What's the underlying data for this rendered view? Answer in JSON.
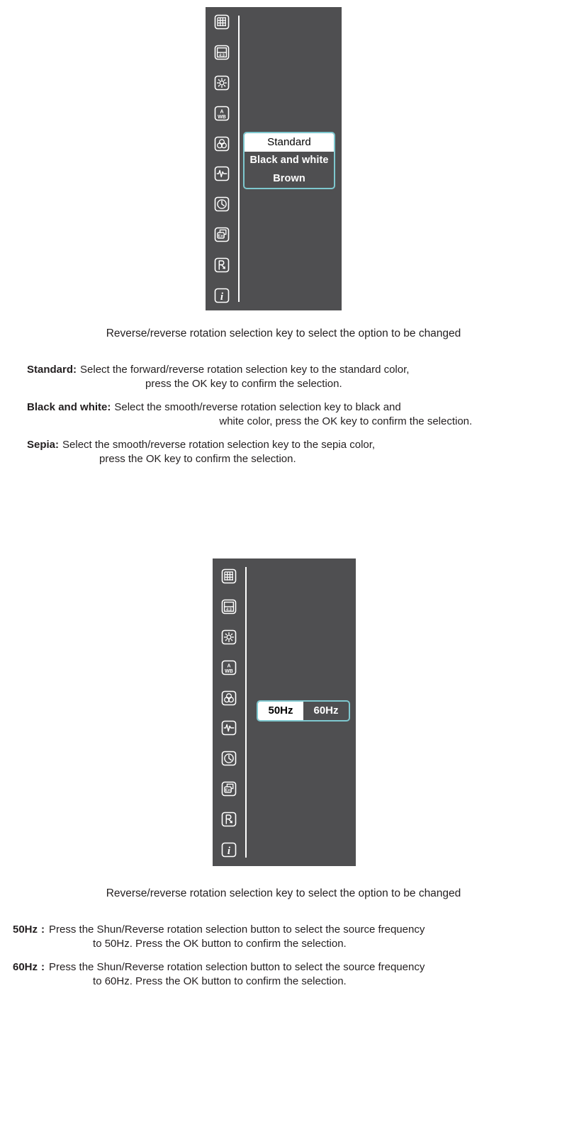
{
  "panels": [
    {
      "id": "color-mode-panel",
      "icons": [
        {
          "name": "grid-icon",
          "label": "Grid"
        },
        {
          "name": "aspect-ratio-4-3-icon",
          "label": "4:3"
        },
        {
          "name": "brightness-icon",
          "label": "Brightness"
        },
        {
          "name": "auto-white-balance-icon",
          "label": "A WB"
        },
        {
          "name": "color-mode-icon",
          "label": "Color mode"
        },
        {
          "name": "sharpness-icon",
          "label": "Sharpness"
        },
        {
          "name": "timer-icon",
          "label": "Timer"
        },
        {
          "name": "language-icon",
          "label": "En"
        },
        {
          "name": "reset-icon",
          "label": "Reset"
        },
        {
          "name": "info-icon",
          "label": "i"
        }
      ],
      "menu": {
        "name": "color-mode-menu",
        "options": [
          {
            "label": "Standard",
            "selected": true
          },
          {
            "label": "Black and white",
            "selected": false
          },
          {
            "label": "Brown",
            "selected": false
          }
        ]
      }
    },
    {
      "id": "frequency-panel",
      "icons": [
        {
          "name": "grid-icon",
          "label": "Grid"
        },
        {
          "name": "aspect-ratio-4-3-icon",
          "label": "4:3"
        },
        {
          "name": "brightness-icon",
          "label": "Brightness"
        },
        {
          "name": "auto-white-balance-icon",
          "label": "A WB"
        },
        {
          "name": "color-mode-icon",
          "label": "Color mode"
        },
        {
          "name": "sharpness-icon",
          "label": "Sharpness"
        },
        {
          "name": "timer-icon",
          "label": "Timer"
        },
        {
          "name": "language-icon",
          "label": "En"
        },
        {
          "name": "reset-icon",
          "label": "Reset"
        },
        {
          "name": "info-icon",
          "label": "i"
        }
      ],
      "menu": {
        "name": "frequency-toggle",
        "options": [
          {
            "label": "50Hz",
            "selected": true
          },
          {
            "label": "60Hz",
            "selected": false
          }
        ]
      }
    }
  ],
  "captions": {
    "color": "Reverse/reverse rotation selection key to select the option to be changed",
    "frequency": "Reverse/reverse rotation selection key to select the option to be changed"
  },
  "color_descriptions": [
    {
      "term": "Standard:",
      "line1": "Select the forward/reverse rotation selection key to the standard color,",
      "line2": "press the OK key to confirm the selection."
    },
    {
      "term": "Black and white:",
      "line1": "Select the smooth/reverse rotation selection key to black and",
      "line2": "white color, press the OK key to confirm the selection."
    },
    {
      "term": "Sepia:",
      "line1": "Select the smooth/reverse rotation selection key to the sepia color,",
      "line2": "press the OK key to confirm the selection."
    }
  ],
  "frequency_descriptions": [
    {
      "term": "50Hz",
      "separator": ":",
      "line1": "Press the Shun/Reverse rotation selection button to select the source frequency",
      "line2": "to 50Hz. Press the OK button to confirm the selection."
    },
    {
      "term": "60Hz",
      "separator": ":",
      "line1": "Press the Shun/Reverse rotation selection button to select the source frequency",
      "line2": "to 60Hz. Press the OK button to confirm the selection."
    }
  ],
  "colors": {
    "panel_background": "#4f4f51",
    "menu_border": "#7ec8cf",
    "selected_background": "#ffffff",
    "text": "#231f20"
  }
}
